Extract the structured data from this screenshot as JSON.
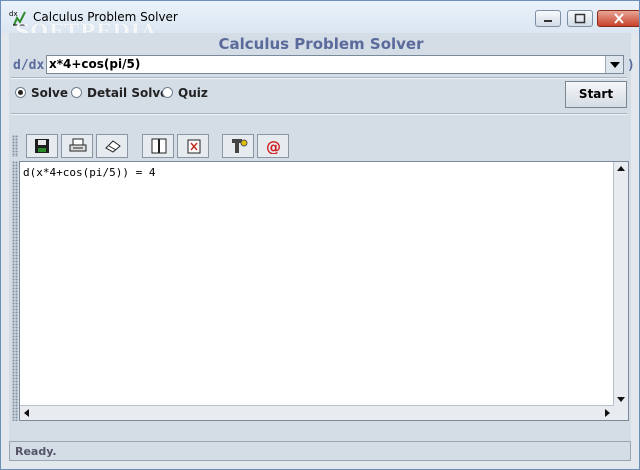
{
  "window": {
    "title": "Calculus Problem Solver",
    "watermark": "SOFTPEDIA",
    "heading": "Calculus Problem Solver"
  },
  "expression": {
    "prefix": "d/dx(",
    "value": "x*4+cos(pi/5)",
    "suffix": ")"
  },
  "options": [
    {
      "label": "Solve",
      "selected": true
    },
    {
      "label": "Detail Solve",
      "selected": false
    },
    {
      "label": "Quiz",
      "selected": false
    }
  ],
  "start_label": "Start",
  "toolbar": [
    "save-icon",
    "print-icon",
    "clear-icon",
    "split-view-icon",
    "trash-icon",
    "settings-icon",
    "email-icon"
  ],
  "output": {
    "text": "d(x*4+cos(pi/5)) = 4"
  },
  "status": {
    "text": "Ready."
  },
  "colors": {
    "accent": "#5a6a9a",
    "panel": "#d4dce6"
  }
}
